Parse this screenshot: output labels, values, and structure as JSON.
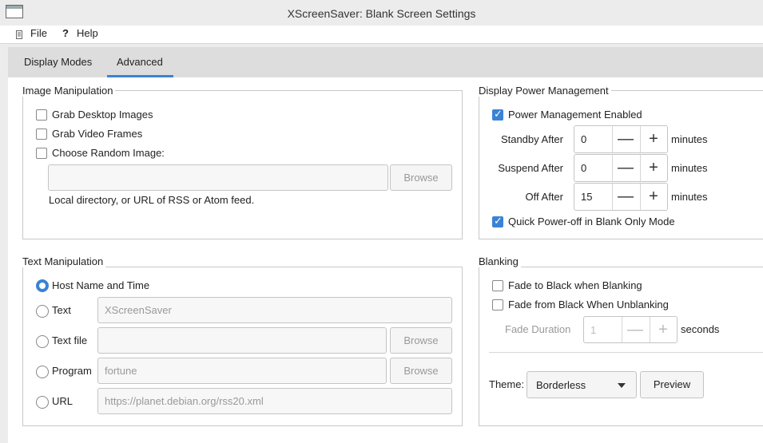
{
  "window": {
    "title": "XScreenSaver: Blank Screen Settings"
  },
  "menu": {
    "file": "File",
    "help": "Help",
    "help_glyph": "?"
  },
  "tabs": [
    {
      "label": "Display Modes",
      "active": false
    },
    {
      "label": "Advanced",
      "active": true
    }
  ],
  "image_manip": {
    "title": "Image Manipulation",
    "grab_desktop": {
      "label": "Grab Desktop Images",
      "checked": false
    },
    "grab_video": {
      "label": "Grab Video Frames",
      "checked": false
    },
    "choose_random": {
      "label": "Choose Random Image:",
      "checked": false
    },
    "path_value": "",
    "browse": "Browse",
    "hint": "Local directory, or URL of RSS or Atom feed."
  },
  "text_manip": {
    "title": "Text Manipulation",
    "host": {
      "label": "Host Name and Time",
      "selected": true
    },
    "text": {
      "label": "Text",
      "value": "XScreenSaver"
    },
    "text_file": {
      "label": "Text file",
      "value": "",
      "browse": "Browse"
    },
    "program": {
      "label": "Program",
      "value": "fortune",
      "browse": "Browse"
    },
    "url": {
      "label": "URL",
      "value": "https://planet.debian.org/rss20.xml"
    }
  },
  "power": {
    "title": "Display Power Management",
    "enabled": {
      "label": "Power Management Enabled",
      "checked": true
    },
    "standby": {
      "label": "Standby After",
      "value": "0",
      "unit": "minutes"
    },
    "suspend": {
      "label": "Suspend After",
      "value": "0",
      "unit": "minutes"
    },
    "off": {
      "label": "Off After",
      "value": "15",
      "unit": "minutes"
    },
    "quick_off": {
      "label": "Quick Power-off in Blank Only Mode",
      "checked": true
    }
  },
  "blanking": {
    "title": "Blanking",
    "fade_to": {
      "label": "Fade to Black when Blanking",
      "checked": false
    },
    "fade_from": {
      "label": "Fade from Black When Unblanking",
      "checked": false
    },
    "fade_duration": {
      "label": "Fade Duration",
      "value": "1",
      "unit": "seconds"
    },
    "theme_label": "Theme:",
    "theme_value": "Borderless",
    "preview": "Preview"
  },
  "glyphs": {
    "minus": "—",
    "plus": "+"
  },
  "colors": {
    "accent": "#3b82d6",
    "background": "#ececec"
  }
}
